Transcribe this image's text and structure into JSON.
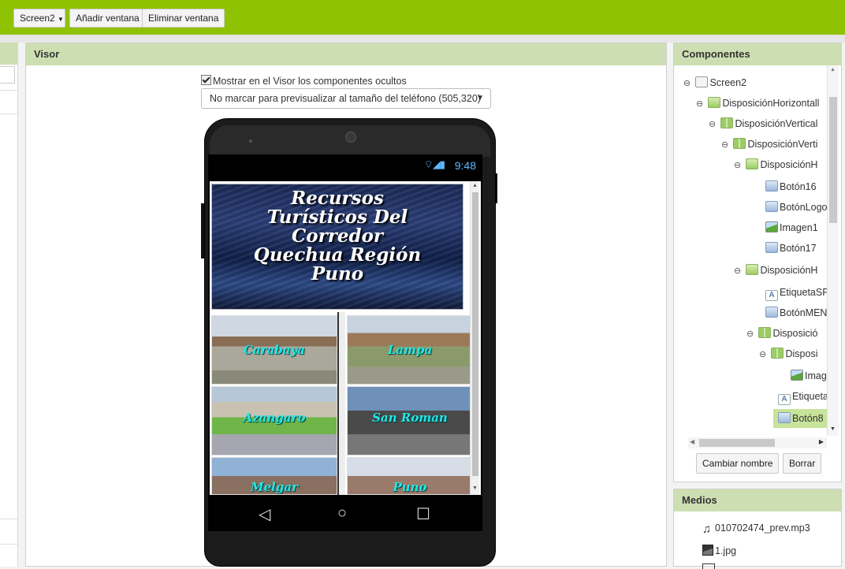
{
  "toolbar": {
    "screen_select": "Screen2",
    "add_window": "Añadir ventana",
    "remove_window": "Eliminar ventana"
  },
  "visor": {
    "title": "Visor",
    "show_hidden_label": "Mostrar en el Visor los componentes ocultos",
    "show_hidden_checked": true,
    "preview_size": "No marcar para previsualizar al tamaño del teléfono (505,320)"
  },
  "phone": {
    "time": "9:48",
    "banner_lines": [
      "Recursos",
      "Turísticos Del",
      "Corredor",
      "Quechua Región",
      "Puno"
    ],
    "tiles": [
      "Carabaya",
      "Lampa",
      "Azangaro",
      "San Roman",
      "Melgar",
      "Puno"
    ],
    "nav": {
      "back": "◁",
      "home": "○",
      "recent": "☐"
    }
  },
  "components": {
    "title": "Componentes",
    "tree": [
      {
        "label": "Screen2",
        "icon": "screen-icon",
        "toggle": "⊖"
      },
      {
        "label": "DisposiciónHorizontall",
        "icon": "horizontal-arrangement-icon",
        "toggle": "⊖"
      },
      {
        "label": "DisposiciónVertical",
        "icon": "vertical-arrangement-icon",
        "toggle": "⊖"
      },
      {
        "label": "DisposiciónVerti",
        "icon": "vertical-arrangement-icon",
        "toggle": "⊖"
      },
      {
        "label": "DisposiciónH",
        "icon": "horizontal-arrangement-icon",
        "toggle": "⊖"
      },
      {
        "label": "Botón16",
        "icon": "button-icon",
        "toggle": ""
      },
      {
        "label": "BotónLogo",
        "icon": "button-icon",
        "toggle": ""
      },
      {
        "label": "Imagen1",
        "icon": "image-icon",
        "toggle": ""
      },
      {
        "label": "Botón17",
        "icon": "button-icon",
        "toggle": ""
      },
      {
        "label": "DisposiciónH",
        "icon": "horizontal-arrangement-icon",
        "toggle": "⊖"
      },
      {
        "label": "EtiquetaSP",
        "icon": "label-icon",
        "toggle": ""
      },
      {
        "label": "BotónMEN",
        "icon": "button-icon",
        "toggle": ""
      },
      {
        "label": "Disposició",
        "icon": "vertical-arrangement-icon",
        "toggle": "⊖"
      },
      {
        "label": "Disposi",
        "icon": "vertical-arrangement-icon",
        "toggle": "⊖"
      },
      {
        "label": "Imag",
        "icon": "image-icon",
        "toggle": ""
      },
      {
        "label": "Etiqueta",
        "icon": "label-icon",
        "toggle": ""
      },
      {
        "label": "Botón8",
        "icon": "button-icon",
        "toggle": "",
        "selected": true
      }
    ],
    "rename_button": "Cambiar nombre",
    "delete_button": "Borrar"
  },
  "media": {
    "title": "Medios",
    "items": [
      {
        "name": "010702474_prev.mp3",
        "icon": "music-note-icon"
      },
      {
        "name": "1.jpg",
        "icon": "picture-icon"
      }
    ]
  }
}
